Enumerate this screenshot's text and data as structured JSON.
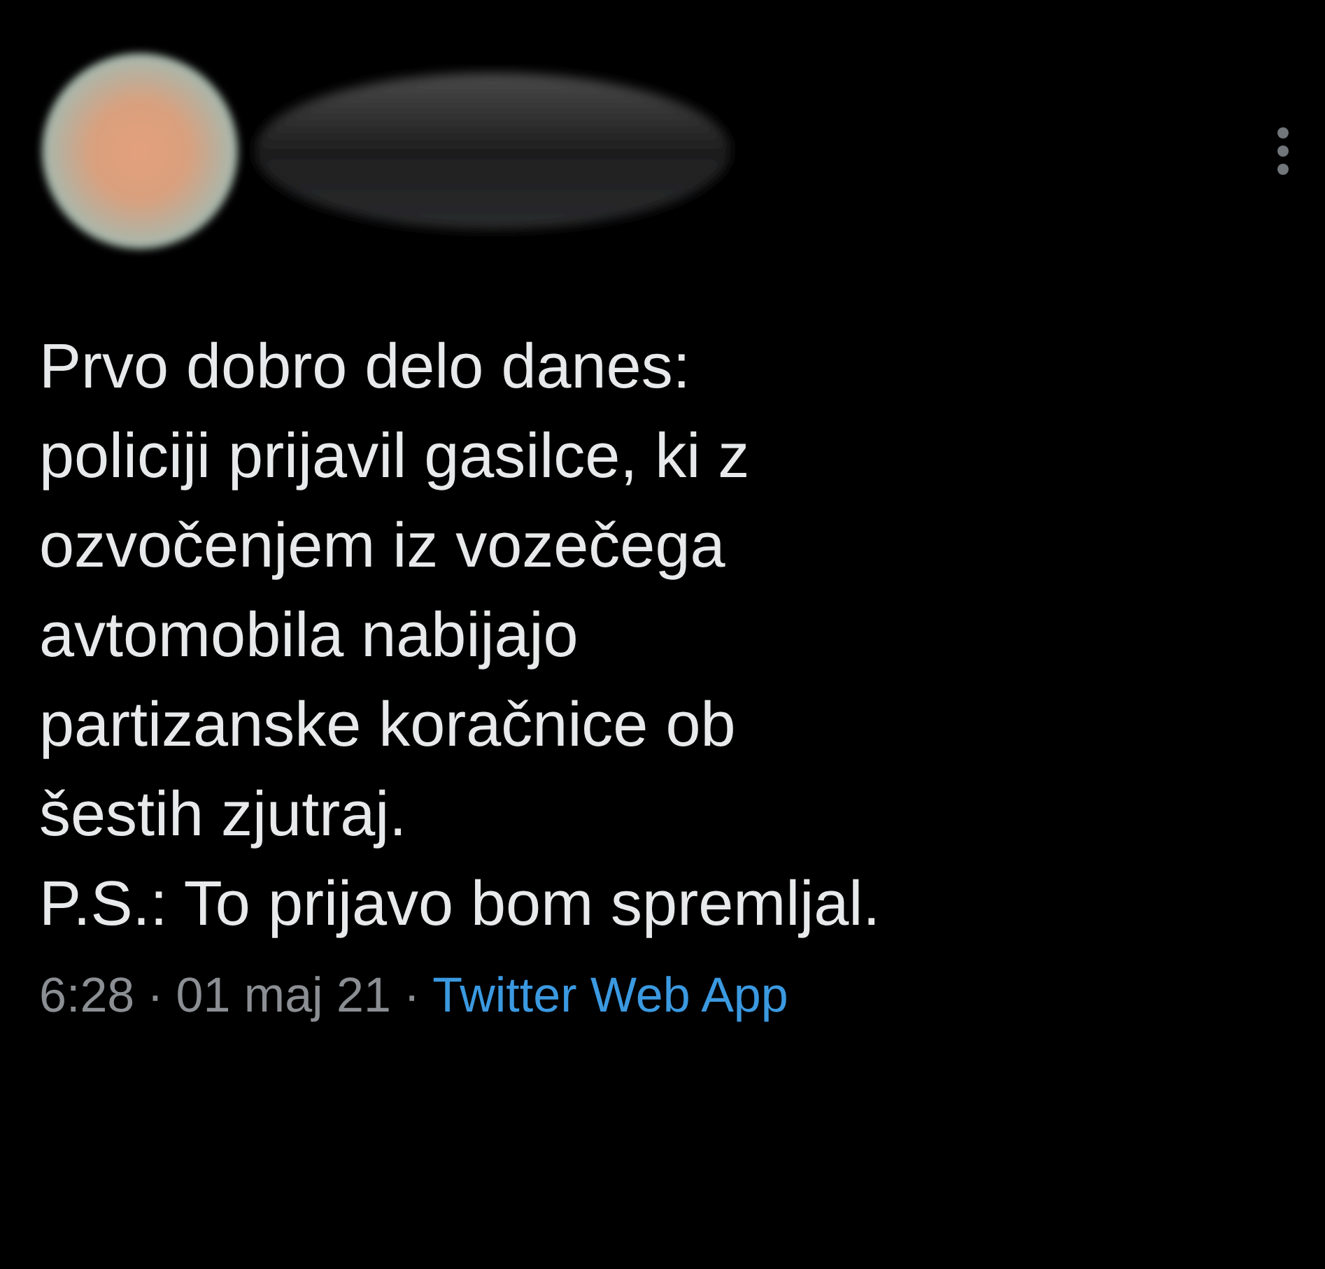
{
  "tweet": {
    "text": "Prvo dobro delo danes:\npoliciji prijavil gasilce, ki z\nozvočenjem iz vozečega\navtomobila nabijajo\npartizanske koračnice ob\nšestih zjutraj.\nP.S.: To prijavo bom spremljal.",
    "time": "6:28",
    "separator_1": "·",
    "date": "01 maj 21",
    "separator_2": "·",
    "source": "Twitter Web App"
  }
}
